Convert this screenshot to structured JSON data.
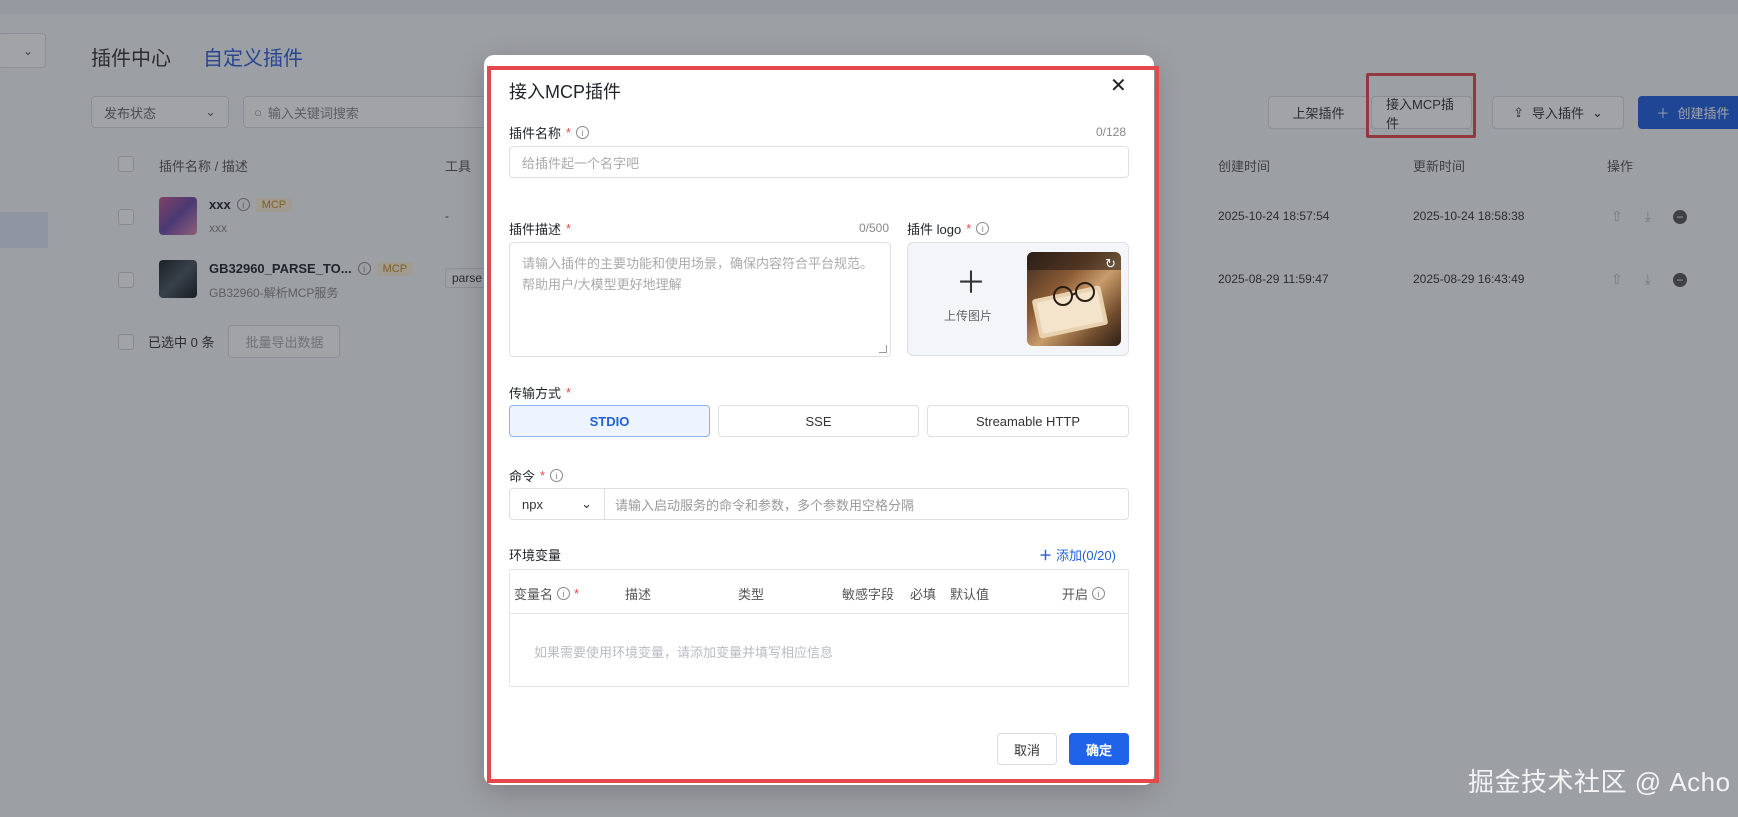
{
  "page": {
    "tabs": [
      "插件中心",
      "自定义插件"
    ],
    "filter_status": "发布状态",
    "search_placeholder": "输入关键词搜索",
    "toolbar": {
      "shelf": "上架插件",
      "connect_mcp": "接入MCP插件",
      "import": "导入插件",
      "create": "创建插件"
    },
    "columns": {
      "name": "插件名称 / 描述",
      "tool": "工具",
      "created": "创建时间",
      "updated": "更新时间",
      "actions": "操作"
    },
    "rows": [
      {
        "name": "xxx",
        "badge": "MCP",
        "desc": "xxx",
        "tool": "-",
        "created": "2025-10-24 18:57:54",
        "updated": "2025-10-24 18:58:38"
      },
      {
        "name": "GB32960_PARSE_TO...",
        "badge": "MCP",
        "desc": "GB32960-解析MCP服务",
        "tool": "parse",
        "created": "2025-08-29 11:59:47",
        "updated": "2025-08-29 16:43:49"
      }
    ],
    "selected_text": "已选中 0 条",
    "export_button": "批量导出数据"
  },
  "modal": {
    "title": "接入MCP插件",
    "close_icon": "close-icon",
    "name_label": "插件名称",
    "name_counter": "0/128",
    "name_placeholder": "给插件起一个名字吧",
    "desc_label": "插件描述",
    "desc_counter": "0/500",
    "desc_placeholder_line1": "请输入插件的主要功能和使用场景，确保内容符合平台规范。",
    "desc_placeholder_line2": "帮助用户/大模型更好地理解",
    "logo_label": "插件 logo",
    "upload_text": "上传图片",
    "transport_label": "传输方式",
    "transport_options": [
      "STDIO",
      "SSE",
      "Streamable HTTP"
    ],
    "transport_selected": "STDIO",
    "command_label": "命令",
    "command_select": "npx",
    "command_placeholder": "请输入启动服务的命令和参数，多个参数用空格分隔",
    "env_label": "环境变量",
    "env_add": "添加(0/20)",
    "env_columns": [
      "变量名",
      "描述",
      "类型",
      "敏感字段",
      "必填",
      "默认值",
      "开启"
    ],
    "env_empty": "如果需要使用环境变量，请添加变量并填写相应信息",
    "cancel": "取消",
    "confirm": "确定"
  },
  "watermark": "掘金技术社区 @ Acho",
  "colors": {
    "primary": "#1f63e8",
    "highlight_frame": "#e5484d",
    "required": "#e5484d",
    "badge_text": "#c08a1b"
  }
}
